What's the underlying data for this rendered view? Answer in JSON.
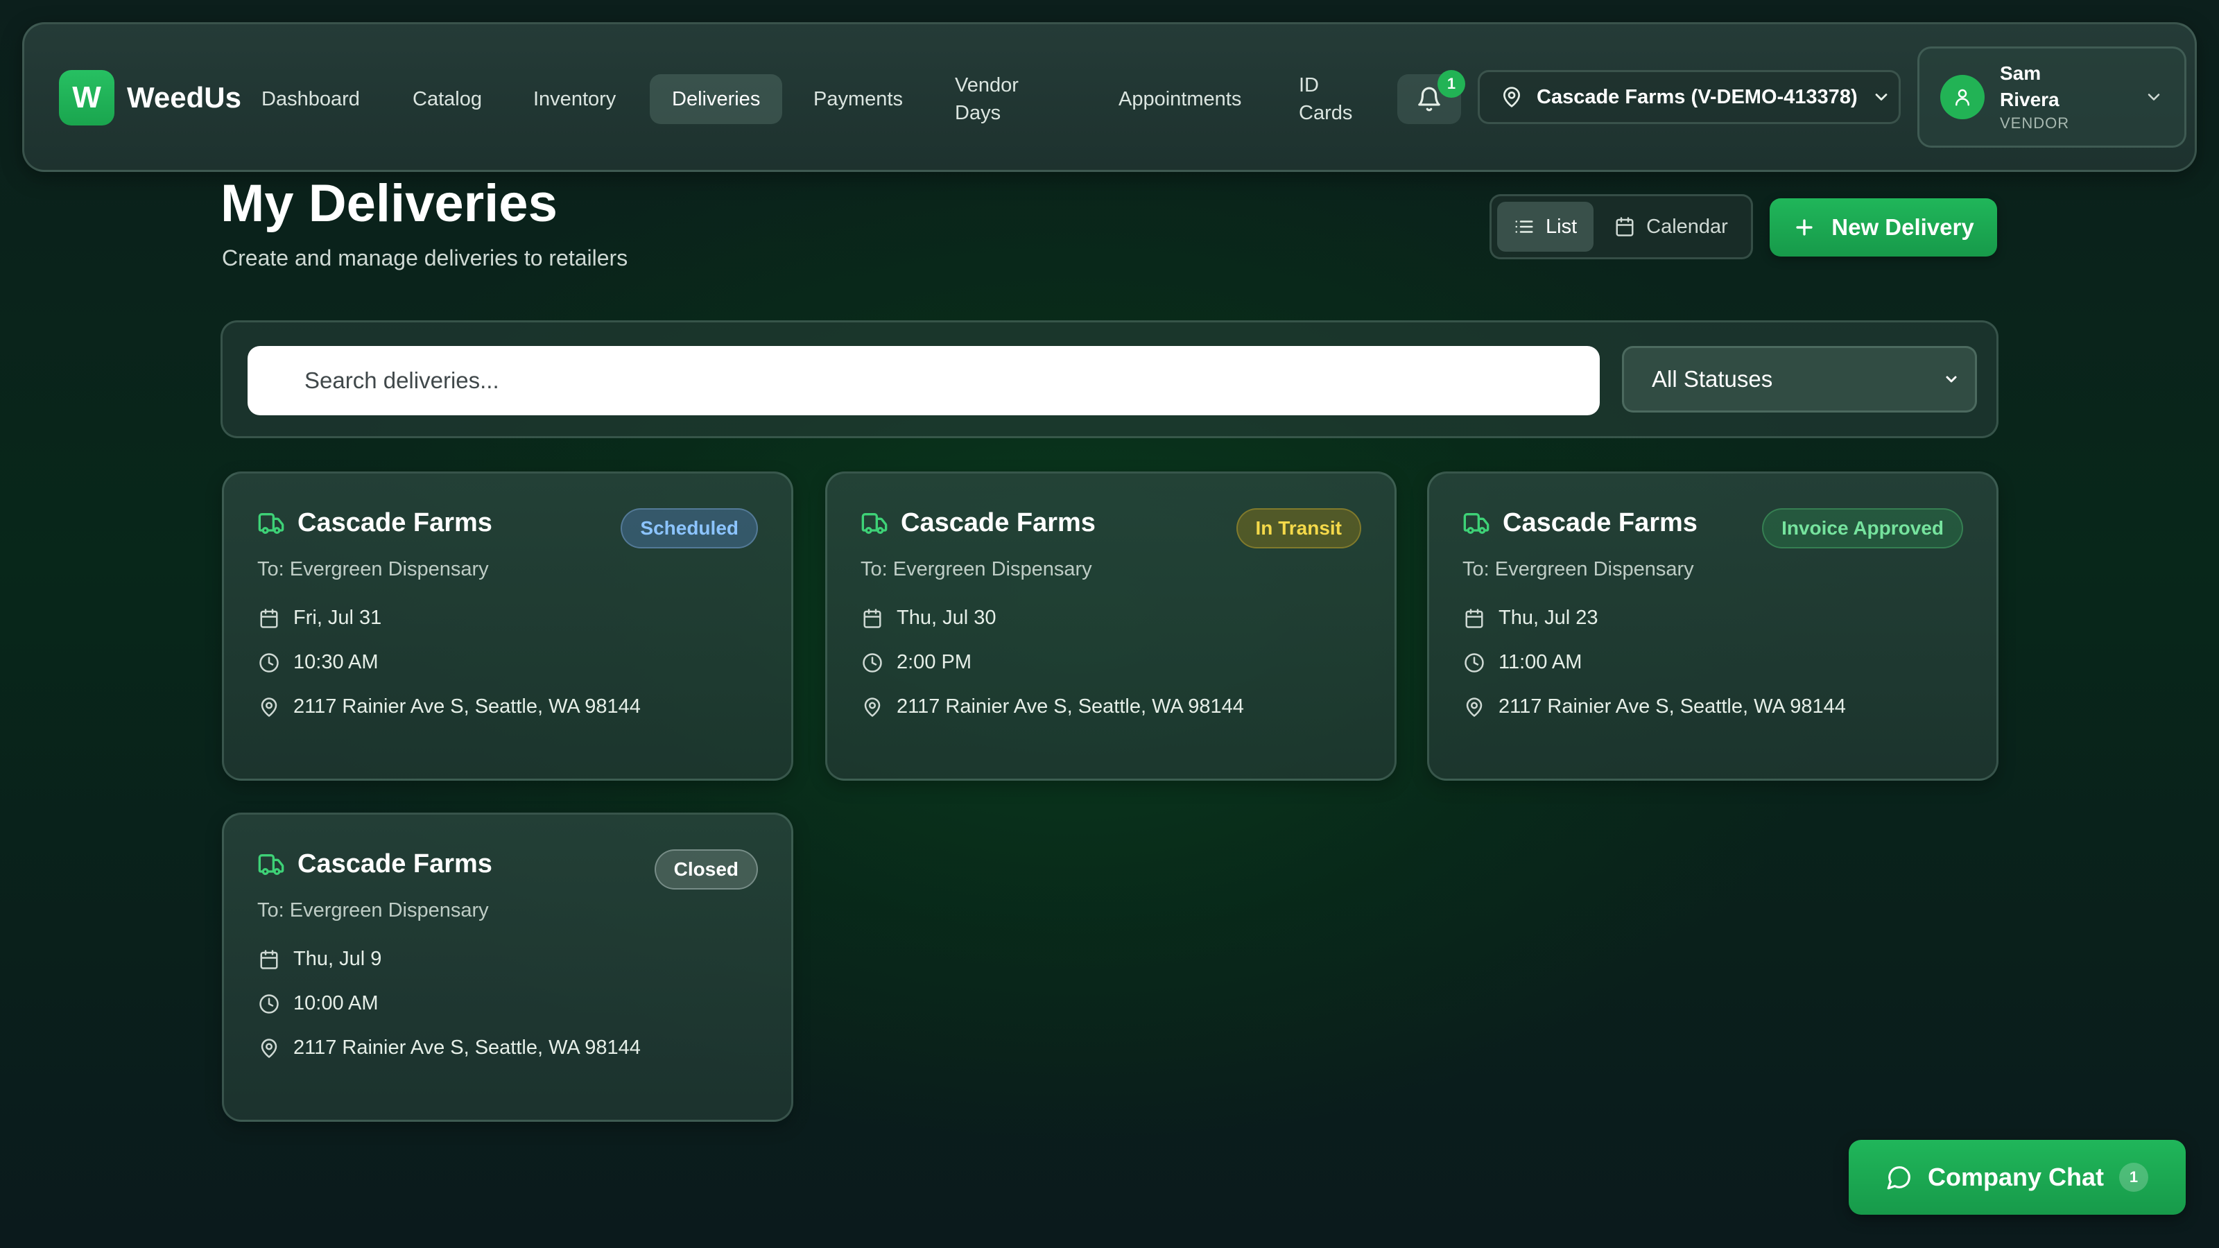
{
  "app": {
    "logo_letter": "W",
    "name": "WeedUs"
  },
  "nav": {
    "items": [
      {
        "label": "Dashboard"
      },
      {
        "label": "Catalog"
      },
      {
        "label": "Inventory"
      },
      {
        "label": "Deliveries",
        "active": true
      },
      {
        "label": "Payments"
      },
      {
        "label": "Vendor Days"
      },
      {
        "label": "Appointments"
      },
      {
        "label": "ID Cards"
      }
    ],
    "notifications_count": "1",
    "location": "Cascade Farms (V-DEMO-413378)",
    "user": {
      "name": "Sam Rivera",
      "role": "VENDOR"
    }
  },
  "page": {
    "title": "My Deliveries",
    "subtitle": "Create and manage deliveries to retailers"
  },
  "view_toggle": {
    "list_label": "List",
    "calendar_label": "Calendar",
    "active": "List"
  },
  "actions": {
    "new_delivery_label": "New Delivery"
  },
  "filters": {
    "search_placeholder": "Search deliveries...",
    "status_value": "All Statuses"
  },
  "deliveries": [
    {
      "vendor": "Cascade Farms",
      "status": "Scheduled",
      "to": "To: Evergreen Dispensary",
      "date": "Fri, Jul 31",
      "time": "10:30 AM",
      "address": "2117 Rainier Ave S, Seattle, WA 98144"
    },
    {
      "vendor": "Cascade Farms",
      "status": "In Transit",
      "to": "To: Evergreen Dispensary",
      "date": "Thu, Jul 30",
      "time": "2:00 PM",
      "address": "2117 Rainier Ave S, Seattle, WA 98144"
    },
    {
      "vendor": "Cascade Farms",
      "status": "Invoice Approved",
      "to": "To: Evergreen Dispensary",
      "date": "Thu, Jul 23",
      "time": "11:00 AM",
      "address": "2117 Rainier Ave S, Seattle, WA 98144"
    },
    {
      "vendor": "Cascade Farms",
      "status": "Closed",
      "to": "To: Evergreen Dispensary",
      "date": "Thu, Jul 9",
      "time": "10:00 AM",
      "address": "2117 Rainier Ave S, Seattle, WA 98144"
    }
  ],
  "chat": {
    "label": "Company Chat",
    "count": "1"
  },
  "colors": {
    "accent_green": "#1faa52",
    "scheduled": "#8cc4ff",
    "in_transit": "#f5d94a",
    "invoice_approved": "#76e39e",
    "closed": "#ffffff"
  },
  "icons": {
    "bell": "bell-icon",
    "location": "map-pin-icon",
    "user": "user-icon",
    "chevron": "chevron-down-icon",
    "list": "list-icon",
    "calendar": "calendar-icon",
    "plus": "plus-icon",
    "search": "search-icon",
    "truck": "truck-icon",
    "clock": "clock-icon",
    "chat": "chat-bubble-icon"
  }
}
